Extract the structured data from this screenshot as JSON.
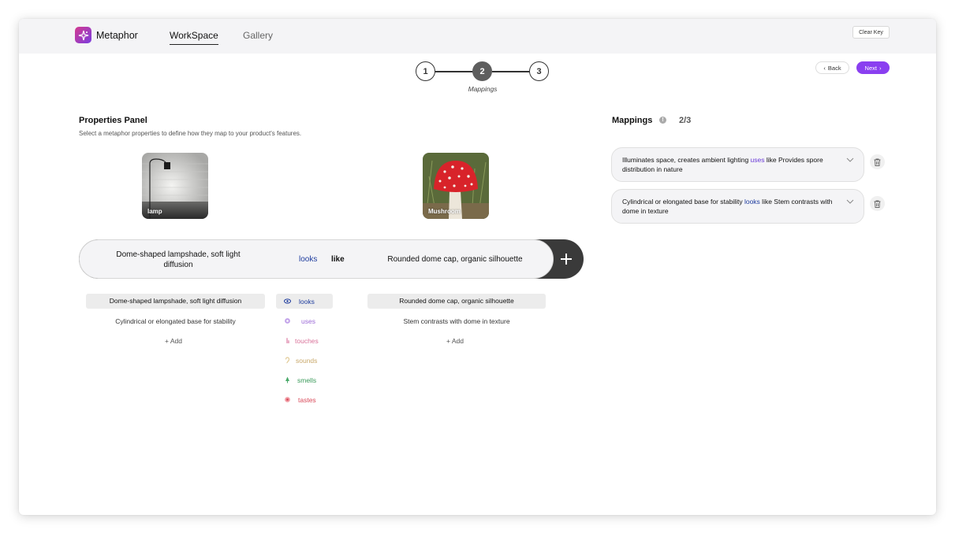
{
  "app": {
    "name": "Metaphor"
  },
  "nav": {
    "tabs": [
      {
        "label": "WorkSpace",
        "active": true
      },
      {
        "label": "Gallery",
        "active": false
      }
    ]
  },
  "header": {
    "clear_key": "Clear Key"
  },
  "stepper": {
    "steps": [
      "1",
      "2",
      "3"
    ],
    "current": 2,
    "caption": "Mappings"
  },
  "actions": {
    "back": "Back",
    "next": "Next"
  },
  "properties_panel": {
    "title": "Properties Panel",
    "subtitle": "Select a metaphor properties to define how they map to your product's features.",
    "source": {
      "label": "lamp"
    },
    "target": {
      "label": "Mushroom"
    }
  },
  "mapping_bar": {
    "left": "Dome-shaped lampshade, soft light diffusion",
    "verb": "looks",
    "like": "like",
    "right": "Rounded dome cap, organic silhouette"
  },
  "source_properties": {
    "items": [
      "Dome-shaped lampshade, soft light diffusion",
      "Cylindrical or elongated base for stability"
    ],
    "selected": 0,
    "add": "Add"
  },
  "relations": {
    "items": [
      {
        "label": "looks",
        "icon": "eye-icon",
        "color": "#1e3c9e"
      },
      {
        "label": "uses",
        "icon": "gear-icon",
        "color": "#9b6ad6"
      },
      {
        "label": "touches",
        "icon": "hand-icon",
        "color": "#d9729a"
      },
      {
        "label": "sounds",
        "icon": "ear-icon",
        "color": "#c9a86a"
      },
      {
        "label": "smells",
        "icon": "nose-icon",
        "color": "#3a9a5a"
      },
      {
        "label": "tastes",
        "icon": "tongue-icon",
        "color": "#d94a5a"
      }
    ],
    "selected": 0
  },
  "target_properties": {
    "items": [
      "Rounded dome cap, organic silhouette",
      "Stem contrasts with dome in texture"
    ],
    "selected": 0,
    "add": "Add"
  },
  "mappings": {
    "title": "Mappings",
    "count": "2/3",
    "items": [
      {
        "before": "Illuminates space, creates ambient lighting ",
        "verb": "uses",
        "mid": " like ",
        "after": "Provides spore distribution in nature"
      },
      {
        "before": "Cylindrical or elongated base for stability ",
        "verb": "looks",
        "mid": " like ",
        "after": "Stem contrasts with dome in texture"
      }
    ]
  }
}
